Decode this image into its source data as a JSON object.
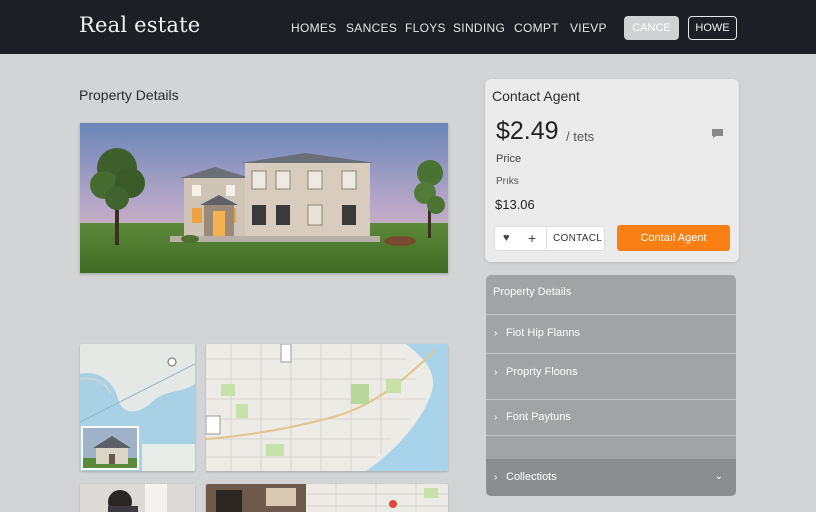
{
  "header": {
    "brand": "Real estate",
    "nav": [
      "HOMES",
      "SANCES",
      "FLOYS",
      "SINDING",
      "COMPT",
      "VIEVP"
    ],
    "cancel_label": "CANCE",
    "home_label": "HOWE"
  },
  "main": {
    "section_title": "Property Details"
  },
  "contact": {
    "title": "Contact Agent",
    "price": "$2.49",
    "unit": "/ tets",
    "label_price": "Price",
    "label_secondary": "Prıks",
    "amount": "$13.06",
    "contact_link": "CONTACL",
    "agent_button": "Contaıl Agent"
  },
  "accordion": {
    "title": "Property Details",
    "items": [
      "Fiot Hip Flanns",
      "Proprty Floons",
      "Font Paytuns"
    ],
    "last_item": "Collectiots"
  },
  "colors": {
    "topbar": "#1c1f23",
    "accent": "#fb7f12",
    "page_bg": "#d3d4d5"
  },
  "icons": [
    "heart-icon",
    "plus-icon",
    "message-icon",
    "chevron-right-icon",
    "chevron-down-icon"
  ]
}
